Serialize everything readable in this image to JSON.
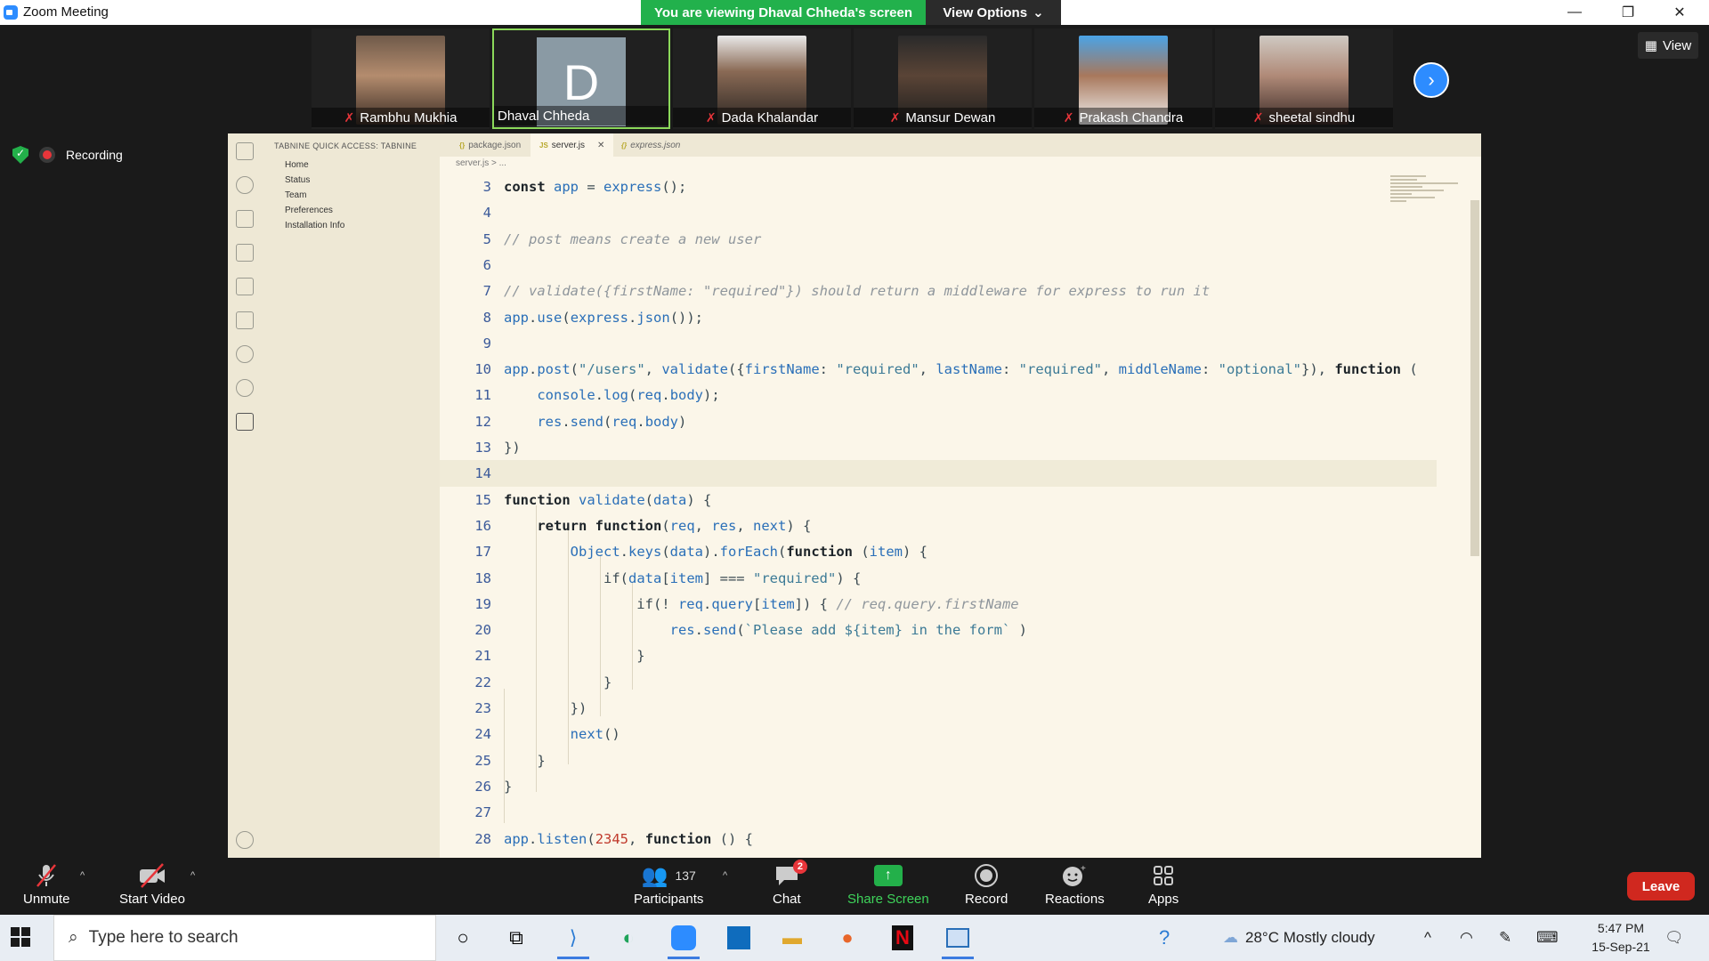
{
  "window": {
    "title": "Zoom Meeting",
    "share_banner": "You are viewing Dhaval Chheda's screen",
    "view_options": "View Options"
  },
  "participants": [
    {
      "name": "Rambhu Mukhia",
      "muted": true,
      "avatar": "photo"
    },
    {
      "name": "Dhaval Chheda",
      "muted": false,
      "avatar": "D"
    },
    {
      "name": "Dada Khalandar",
      "muted": true,
      "avatar": "photo"
    },
    {
      "name": "Mansur Dewan",
      "muted": true,
      "avatar": "photo"
    },
    {
      "name": "Prakash Chandra",
      "muted": true,
      "avatar": "photo"
    },
    {
      "name": "sheetal sindhu",
      "muted": true,
      "avatar": "photo"
    }
  ],
  "view_button": "View",
  "recording_label": "Recording",
  "vscode": {
    "sidebar_header": "TABNINE QUICK ACCESS: TABNINE",
    "sidebar_items": [
      "Home",
      "Status",
      "Team",
      "Preferences",
      "Installation Info"
    ],
    "tabs": [
      {
        "label": "package.json",
        "active": false
      },
      {
        "label": "server.js",
        "active": true
      },
      {
        "label": "express.json",
        "active": false
      }
    ],
    "breadcrumb": "server.js > ...",
    "code_lines": [
      {
        "n": "3",
        "text": "const app = express();"
      },
      {
        "n": "4",
        "text": ""
      },
      {
        "n": "5",
        "text": "// post means create a new user"
      },
      {
        "n": "6",
        "text": ""
      },
      {
        "n": "7",
        "text": "// validate({firstName: \"required\"}) should return a middleware for express to run it"
      },
      {
        "n": "8",
        "text": "app.use(express.json());"
      },
      {
        "n": "9",
        "text": ""
      },
      {
        "n": "10",
        "text": "app.post(\"/users\", validate({firstName: \"required\", lastName: \"required\", middleName: \"optional\"}), function ("
      },
      {
        "n": "11",
        "text": "    console.log(req.body);"
      },
      {
        "n": "12",
        "text": "    res.send(req.body)"
      },
      {
        "n": "13",
        "text": "})"
      },
      {
        "n": "14",
        "text": ""
      },
      {
        "n": "15",
        "text": "function validate(data) {"
      },
      {
        "n": "16",
        "text": "    return function(req, res, next) {"
      },
      {
        "n": "17",
        "text": "        Object.keys(data).forEach(function (item) {"
      },
      {
        "n": "18",
        "text": "            if(data[item] === \"required\") {"
      },
      {
        "n": "19",
        "text": "                if(! req.query[item]) { // req.query.firstName"
      },
      {
        "n": "20",
        "text": "                    res.send(`Please add ${item} in the form` )"
      },
      {
        "n": "21",
        "text": "                }"
      },
      {
        "n": "22",
        "text": "            }"
      },
      {
        "n": "23",
        "text": "        })"
      },
      {
        "n": "24",
        "text": "        next()"
      },
      {
        "n": "25",
        "text": "    }"
      },
      {
        "n": "26",
        "text": "}"
      },
      {
        "n": "27",
        "text": ""
      },
      {
        "n": "28",
        "text": "app.listen(2345, function () {"
      }
    ],
    "current_line": "14"
  },
  "toolbar": {
    "unmute": "Unmute",
    "start_video": "Start Video",
    "participants_count": "137",
    "participants": "Participants",
    "chat": "Chat",
    "chat_badge": "2",
    "share_screen": "Share Screen",
    "record": "Record",
    "reactions": "Reactions",
    "apps": "Apps",
    "leave": "Leave"
  },
  "taskbar": {
    "search_placeholder": "Type here to search",
    "weather": "28°C  Mostly cloudy",
    "time": "5:47 PM",
    "date": "15-Sep-21"
  },
  "colors": {
    "zoom_blue": "#2d8cff",
    "share_green": "#22b14c",
    "leave_red": "#d0281f",
    "editor_bg": "#fbf6e9"
  }
}
